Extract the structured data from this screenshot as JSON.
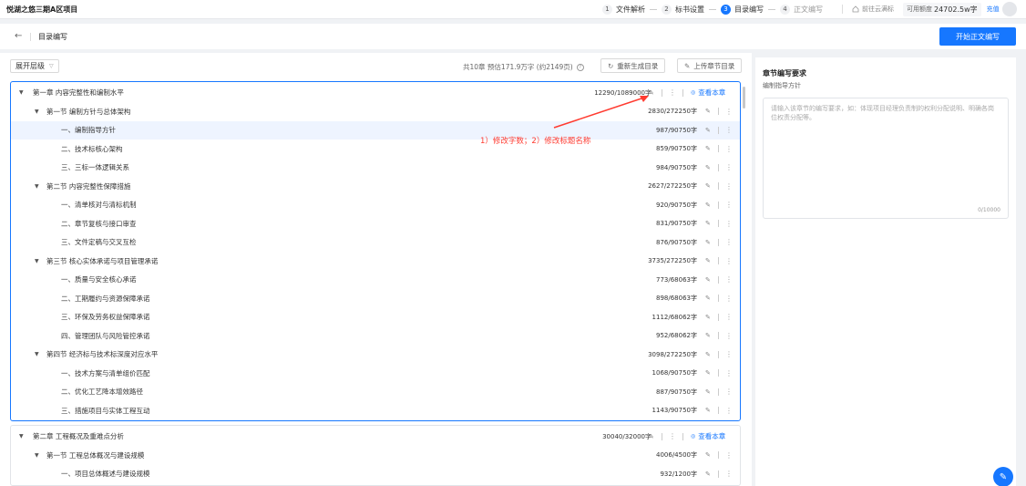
{
  "top": {
    "project_title": "悦湖之悠三期A区项目",
    "steps": [
      {
        "num": "1",
        "label": "文件解析",
        "state": "done"
      },
      {
        "num": "2",
        "label": "标书设置",
        "state": "done"
      },
      {
        "num": "3",
        "label": "目录编写",
        "state": "active"
      },
      {
        "num": "4",
        "label": "正文编写",
        "state": "pending"
      }
    ],
    "cloud_label": "前往云满标",
    "quota_label": "可用额度",
    "quota_value": "24702.5w字",
    "recharge": "充值"
  },
  "header": {
    "back_icon": "arrow-left-icon",
    "title": "目录编写",
    "start_button": "开始正文编写"
  },
  "toolbar": {
    "expand_label": "展开层级",
    "summary": "共10章 预估171.9万字 (约2149页)",
    "regen_label": "重新生成目录",
    "upload_label": "上传章节目录"
  },
  "chapters": [
    {
      "title": "第一章 内容完整性和编制水平",
      "count": "12290/1089000字",
      "view_label": "查看本章",
      "rows": [
        {
          "level": 2,
          "title": "第一节 编制方针与总体架构",
          "count": "2830/272250字"
        },
        {
          "level": 3,
          "title": "一、编制指导方针",
          "count": "987/90750字",
          "highlight": true
        },
        {
          "level": 3,
          "title": "二、技术标核心架构",
          "count": "859/90750字"
        },
        {
          "level": 3,
          "title": "三、三标一体逻辑关系",
          "count": "984/90750字"
        },
        {
          "level": 2,
          "title": "第二节 内容完整性保障措施",
          "count": "2627/272250字"
        },
        {
          "level": 3,
          "title": "一、清单核对与清标机制",
          "count": "920/90750字"
        },
        {
          "level": 3,
          "title": "二、章节复核与接口审查",
          "count": "831/90750字"
        },
        {
          "level": 3,
          "title": "三、文件定稿与交叉互检",
          "count": "876/90750字"
        },
        {
          "level": 2,
          "title": "第三节 核心实体承诺与项目管理承诺",
          "count": "3735/272250字"
        },
        {
          "level": 3,
          "title": "一、质量与安全核心承诺",
          "count": "773/68063字"
        },
        {
          "level": 3,
          "title": "二、工期履约与资源保障承诺",
          "count": "898/68063字"
        },
        {
          "level": 3,
          "title": "三、环保及劳务权益保障承诺",
          "count": "1112/68062字"
        },
        {
          "level": 3,
          "title": "四、管理团队与风险管控承诺",
          "count": "952/68062字"
        },
        {
          "level": 2,
          "title": "第四节 经济标与技术标深度对应水平",
          "count": "3098/272250字"
        },
        {
          "level": 3,
          "title": "一、技术方案与清单组价匹配",
          "count": "1068/90750字"
        },
        {
          "level": 3,
          "title": "二、优化工艺降本增效路径",
          "count": "887/90750字"
        },
        {
          "level": 3,
          "title": "三、措施项目与实体工程互动",
          "count": "1143/90750字"
        }
      ]
    },
    {
      "title": "第二章 工程概况及重难点分析",
      "count": "30040/32000字",
      "view_label": "查看本章",
      "rows": [
        {
          "level": 2,
          "title": "第一节 工程总体概况与建设规模",
          "count": "4006/4500字"
        },
        {
          "level": 3,
          "title": "一、项目总体概述与建设规模",
          "count": "932/1200字"
        }
      ]
    }
  ],
  "annotation": "1）修改字数；2）修改标题名称",
  "side": {
    "title": "章节编写要求",
    "subtitle": "编制指导方针",
    "placeholder": "请输入该章节的编写要求，如：体现项目经理负责制的权利分配说明、明确各岗位权责分配等。",
    "counter": "0/10000"
  },
  "colors": {
    "accent": "#1677ff",
    "annotation": "#ff3b30"
  }
}
